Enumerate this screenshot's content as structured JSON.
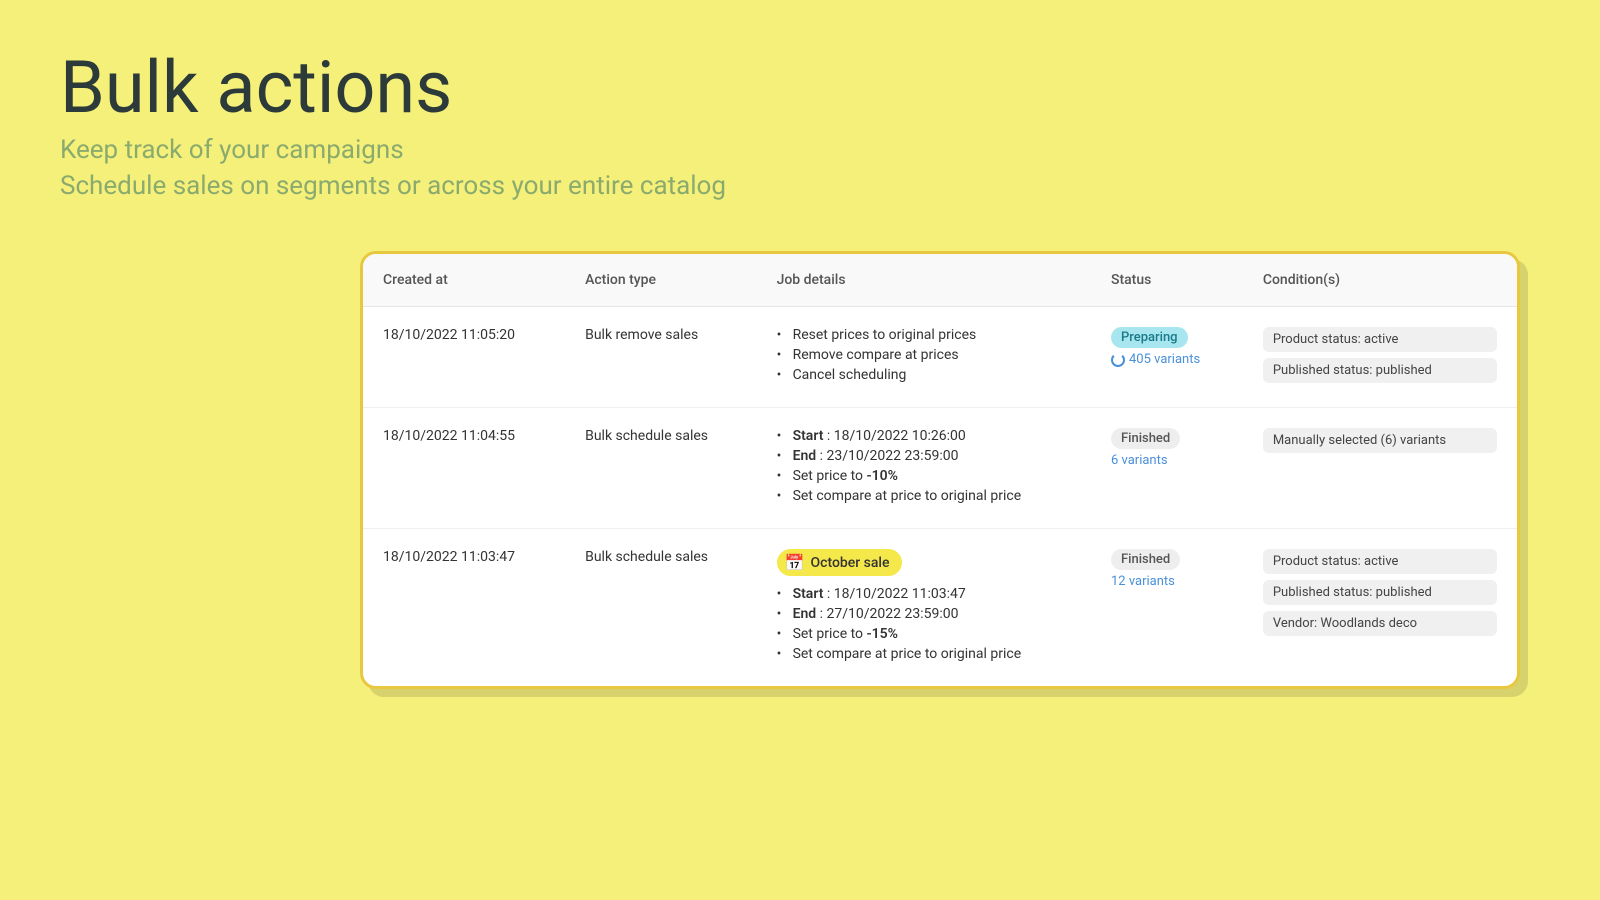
{
  "header": {
    "title": "Bulk actions",
    "subtitle1": "Keep track of your campaigns",
    "subtitle2": "Schedule sales on segments or across your entire catalog"
  },
  "table": {
    "columns": [
      "Created at",
      "Action type",
      "Job details",
      "Status",
      "Condition(s)"
    ],
    "rows": [
      {
        "created_at": "18/10/2022 11:05:20",
        "action_type": "Bulk remove sales",
        "job_details": [
          "Reset prices to original prices",
          "Remove compare at prices",
          "Cancel scheduling"
        ],
        "sale_badge": null,
        "status_label": "Preparing",
        "status_class": "preparing",
        "variants_text": "405 variants",
        "variants_spinner": true,
        "conditions": [
          "Product status: active",
          "Published status: published"
        ]
      },
      {
        "created_at": "18/10/2022 11:04:55",
        "action_type": "Bulk schedule sales",
        "job_details_rich": [
          {
            "label": "Start",
            "value": "18/10/2022 10:26:00"
          },
          {
            "label": "End",
            "value": "23/10/2022 23:59:00"
          },
          {
            "plain": "Set price to ",
            "bold": "-10%"
          },
          {
            "plain": "Set compare at price to original price"
          }
        ],
        "sale_badge": null,
        "status_label": "Finished",
        "status_class": "finished",
        "variants_text": "6 variants",
        "variants_spinner": false,
        "conditions": [
          "Manually selected (6) variants"
        ]
      },
      {
        "created_at": "18/10/2022 11:03:47",
        "action_type": "Bulk schedule sales",
        "job_details_rich": [
          {
            "label": "Start",
            "value": "18/10/2022 11:03:47"
          },
          {
            "label": "End",
            "value": "27/10/2022 23:59:00"
          },
          {
            "plain": "Set price to ",
            "bold": "-15%"
          },
          {
            "plain": "Set compare at price to original price"
          }
        ],
        "sale_badge": "October sale",
        "status_label": "Finished",
        "status_class": "finished",
        "variants_text": "12 variants",
        "variants_spinner": false,
        "conditions": [
          "Product status: active",
          "Published status: published",
          "Vendor: Woodlands deco"
        ]
      }
    ]
  }
}
